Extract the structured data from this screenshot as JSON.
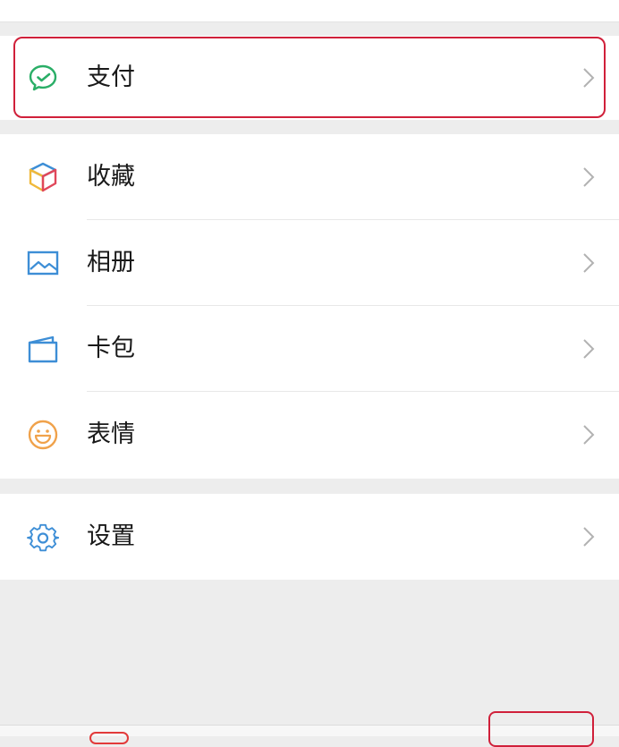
{
  "menu": {
    "pay": {
      "label": "支付",
      "icon": "wechat-pay-icon"
    },
    "items": [
      {
        "label": "收藏",
        "icon": "favorites-cube-icon"
      },
      {
        "label": "相册",
        "icon": "album-image-icon"
      },
      {
        "label": "卡包",
        "icon": "card-wallet-icon"
      },
      {
        "label": "表情",
        "icon": "emoji-smile-icon"
      }
    ],
    "settings": {
      "label": "设置",
      "icon": "gear-icon"
    }
  },
  "colors": {
    "highlight": "#d0203a",
    "pay_green": "#2aae67",
    "blue": "#3d8ed6",
    "emoji_orange": "#f0a24b"
  }
}
